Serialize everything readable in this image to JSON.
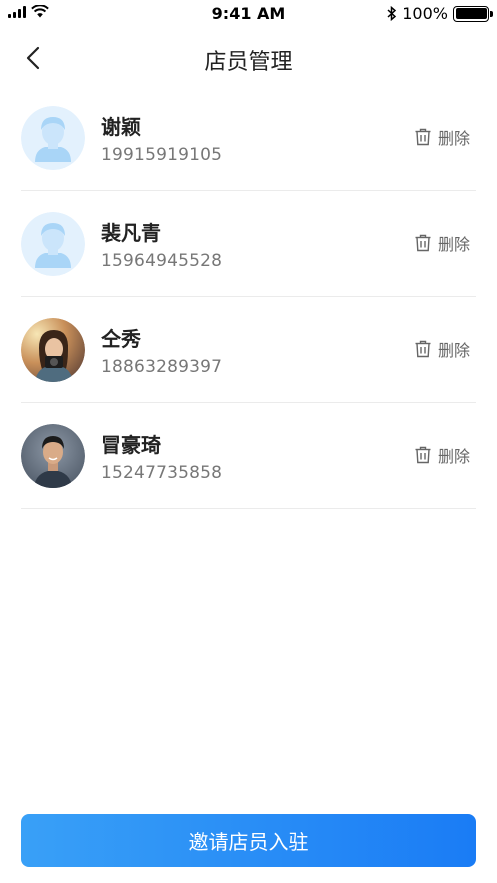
{
  "status_bar": {
    "time": "9:41 AM",
    "battery": "100%",
    "icons": [
      "signal-icon",
      "wifi-icon",
      "bluetooth-icon",
      "battery-icon"
    ]
  },
  "nav": {
    "title": "店员管理",
    "back_icon": "chevron-left-icon"
  },
  "staff": [
    {
      "name": "谢颖",
      "phone": "19915919105",
      "avatar": "placeholder",
      "delete_label": "删除"
    },
    {
      "name": "裴凡青",
      "phone": "15964945528",
      "avatar": "placeholder",
      "delete_label": "删除"
    },
    {
      "name": "仝秀",
      "phone": "18863289397",
      "avatar": "photo-woman",
      "delete_label": "删除"
    },
    {
      "name": "冒豪琦",
      "phone": "15247735858",
      "avatar": "photo-man",
      "delete_label": "删除"
    }
  ],
  "invite_button": {
    "label": "邀请店员入驻"
  },
  "colors": {
    "accent_start": "#39a0f7",
    "accent_end": "#1a7cf5",
    "avatar_placeholder_bg": "#e3f1fd",
    "avatar_placeholder_fg": "#a9d5f7",
    "divider": "#ebebeb"
  }
}
